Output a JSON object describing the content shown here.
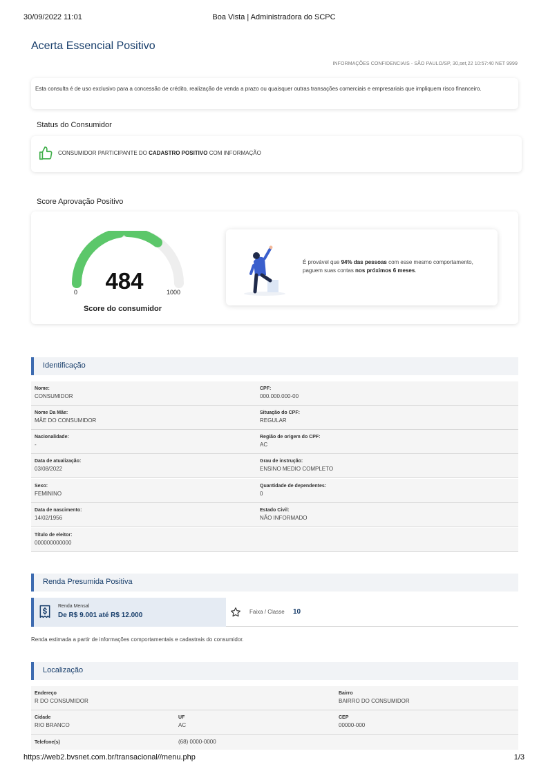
{
  "print_header": {
    "datetime": "30/09/2022 11:01",
    "title": "Boa Vista | Administradora do SCPC"
  },
  "print_footer": {
    "url": "https://web2.bvsnet.com.br/transacional//menu.php",
    "page": "1/3"
  },
  "page_title": "Acerta Essencial Positivo",
  "confidential_line": "INFORMAÇÕES CONFIDENCIAIS - SÃO PAULO/SP, 30,set,22 10:57:40 NET 9999",
  "notice": "Esta consulta é de uso exclusivo para a concessão de crédito, realização de venda a prazo ou quaisquer outras transações comerciais e empresariais que impliquem risco financeiro.",
  "status": {
    "section_title": "Status do Consumidor",
    "text_prefix": "CONSUMIDOR PARTICIPANTE DO ",
    "text_bold": "CADASTRO POSITIVO",
    "text_suffix": " COM INFORMAÇÃO",
    "icon": "thumbs-up-icon",
    "icon_color": "#3fae49"
  },
  "score": {
    "section_title": "Score Aprovação Positivo",
    "value": "484",
    "min": "0",
    "max": "1000",
    "caption": "Score do consumidor",
    "gauge_color": "#5cc76a",
    "gauge_track_color": "#eeeeee",
    "message_pre": "É provável que ",
    "message_bold1": "94% das pessoas",
    "message_mid": " com esse mesmo comportamento, paguem suas contas ",
    "message_bold2": "nos próximos 6 meses",
    "message_end": "."
  },
  "identificacao": {
    "section_title": "Identificação",
    "rows": [
      [
        {
          "label": "Nome:",
          "value": "CONSUMIDOR"
        },
        {
          "label": "CPF:",
          "value": "000.000.000-00"
        }
      ],
      [
        {
          "label": "Nome Da Mãe:",
          "value": "MÃE DO CONSUMIDOR"
        },
        {
          "label": "Situação do CPF:",
          "value": "REGULAR"
        }
      ],
      [
        {
          "label": "Nacionalidade:",
          "value": "-"
        },
        {
          "label": "Região de origem do CPF:",
          "value": "AC"
        }
      ],
      [
        {
          "label": "Data de atualização:",
          "value": "03/08/2022"
        },
        {
          "label": "Grau de instrução:",
          "value": "ENSINO MEDIO COMPLETO"
        }
      ],
      [
        {
          "label": "Sexo:",
          "value": "FEMININO"
        },
        {
          "label": "Quantidade de dependentes:",
          "value": "0"
        }
      ],
      [
        {
          "label": "Data de nascimento:",
          "value": "14/02/1956"
        },
        {
          "label": "Estado Civil:",
          "value": "NÃO INFORMADO"
        }
      ],
      [
        {
          "label": "Título de eleitor:",
          "value": "000000000000"
        }
      ]
    ]
  },
  "renda": {
    "section_title": "Renda Presumida Positiva",
    "mensal_label": "Renda Mensal",
    "mensal_value": "De R$ 9.001 até R$ 12.000",
    "faixa_label": "Faixa / Classe",
    "faixa_value": "10",
    "note": "Renda estimada a partir de informações comportamentais e cadastrais do consumidor."
  },
  "localizacao": {
    "section_title": "Localização",
    "endereco_label": "Endereço",
    "endereco_value": "R DO CONSUMIDOR",
    "bairro_label": "Bairro",
    "bairro_value": "BAIRRO DO CONSUMIDOR",
    "cidade_label": "Cidade",
    "cidade_value": "RIO BRANCO",
    "uf_label": "UF",
    "uf_value": "AC",
    "cep_label": "CEP",
    "cep_value": "00000-000",
    "telefone_label": "Telefone(s)",
    "telefone_value": "(68) 0000-0000"
  }
}
